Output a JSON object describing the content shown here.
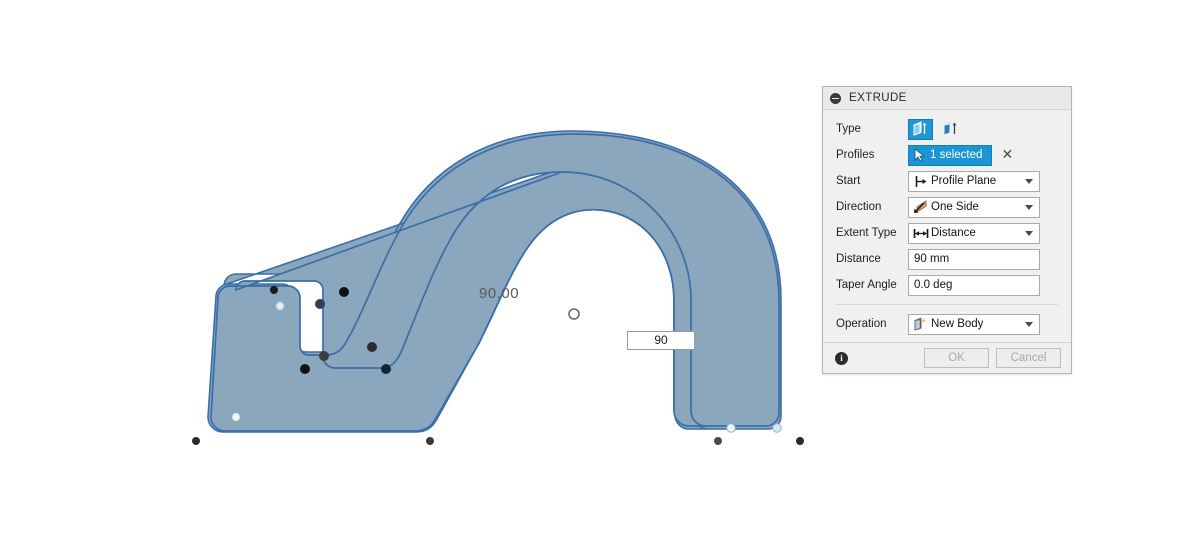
{
  "canvas": {
    "name": "3d-modeling-canvas",
    "background_color": "#ffffff",
    "body": {
      "fill_color": "#8ba7bd",
      "stroke_color": "#3a6ea8",
      "name": "extruded-body-preview"
    },
    "dimension_label": "90.00",
    "dimension_input_value": "90",
    "manipulator_handle": "origin-circle-handle"
  },
  "dialog": {
    "title": "EXTRUDE",
    "collapse_icon": "collapse-minus-icon",
    "rows": {
      "type": {
        "label": "Type",
        "options": [
          {
            "name": "profile-extrude-icon",
            "selected": true
          },
          {
            "name": "loft-extrude-icon",
            "selected": false
          }
        ]
      },
      "profiles": {
        "label": "Profiles",
        "chip_text": "1 selected",
        "chip_icon": "cursor-arrow-icon",
        "clear_icon": "✕"
      },
      "start": {
        "label": "Start",
        "value": "Profile Plane",
        "icon": "profile-plane-icon"
      },
      "direction": {
        "label": "Direction",
        "value": "One Side",
        "icon": "one-side-arrow-icon"
      },
      "extent_type": {
        "label": "Extent Type",
        "value": "Distance",
        "icon": "distance-arrows-icon"
      },
      "distance": {
        "label": "Distance",
        "value": "90 mm"
      },
      "taper_angle": {
        "label": "Taper Angle",
        "value": "0.0 deg"
      },
      "operation": {
        "label": "Operation",
        "value": "New Body",
        "icon": "new-body-icon"
      }
    },
    "footer": {
      "info_icon": "info-icon",
      "info_glyph": "i",
      "ok_label": "OK",
      "cancel_label": "Cancel"
    },
    "accent_color": "#1c95d4"
  }
}
